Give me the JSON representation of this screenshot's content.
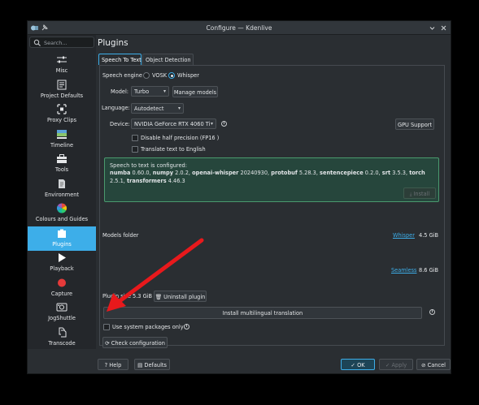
{
  "window": {
    "title": "Configure — Kdenlive"
  },
  "sidebar": {
    "search_placeholder": "Search...",
    "items": [
      {
        "label": "Misc",
        "icon": "misc-icon"
      },
      {
        "label": "Project Defaults",
        "icon": "project-defaults-icon"
      },
      {
        "label": "Proxy Clips",
        "icon": "proxy-clips-icon"
      },
      {
        "label": "Timeline",
        "icon": "timeline-icon"
      },
      {
        "label": "Tools",
        "icon": "tools-icon"
      },
      {
        "label": "Environment",
        "icon": "environment-icon"
      },
      {
        "label": "Colours and Guides",
        "icon": "colours-icon"
      },
      {
        "label": "Plugins",
        "icon": "plugins-icon",
        "active": true
      },
      {
        "label": "Playback",
        "icon": "playback-icon"
      },
      {
        "label": "Capture",
        "icon": "capture-icon"
      },
      {
        "label": "JogShuttle",
        "icon": "jogshuttle-icon"
      },
      {
        "label": "Transcode",
        "icon": "transcode-icon"
      }
    ]
  },
  "main": {
    "title": "Plugins",
    "tabs": [
      {
        "label": "Speech To Text",
        "active": true
      },
      {
        "label": "Object Detection",
        "active": false
      }
    ]
  },
  "stt": {
    "engine_label": "Speech engine",
    "engine_options": [
      "VOSK",
      "Whisper"
    ],
    "engine_selected": "Whisper",
    "model_label": "Model:",
    "model_value": "Turbo",
    "manage_models": "Manage models",
    "language_label": "Language:",
    "language_value": "Autodetect",
    "device_label": "Device:",
    "device_value": "NVIDIA GeForce RTX 4060 Ti",
    "gpu_support": "GPU Support",
    "disable_half": "Disable half precision (FP16 )",
    "translate": "Translate text to English",
    "info_title": "Speech to text is configured:",
    "info_packages": [
      {
        "name": "numba",
        "version": "0.60.0,"
      },
      {
        "name": "numpy",
        "version": "2.0.2,"
      },
      {
        "name": "openai-whisper",
        "version": "20240930,"
      },
      {
        "name": "protobuf",
        "version": "5.28.3,"
      },
      {
        "name": "sentencepiece",
        "version": "0.2.0,"
      },
      {
        "name": "srt",
        "version": "3.5.3,"
      },
      {
        "name": "torch",
        "version": "2.5.1,"
      },
      {
        "name": "transformers",
        "version": "4.46.3"
      }
    ],
    "install": "Install",
    "models_folder": "Models folder",
    "whisper_link": "Whisper",
    "whisper_size": "4.5 GiB",
    "seamless_link": "Seamless",
    "seamless_size": "8.6 GiB",
    "plugin_size_label": "Plugin size",
    "plugin_size_value": "5.3 GiB",
    "uninstall": "Uninstall plugin",
    "install_multilingual": "Install multilingual translation",
    "use_system_packages": "Use system packages only",
    "check_config": "Check configuration"
  },
  "footer": {
    "help": "Help",
    "defaults": "Defaults",
    "ok": "OK",
    "apply": "Apply",
    "cancel": "Cancel"
  },
  "colors": {
    "accent": "#3daee9",
    "annotation_arrow": "#e8191c",
    "info_box_bg": "#26463c",
    "info_box_border": "#4a9a6e"
  }
}
